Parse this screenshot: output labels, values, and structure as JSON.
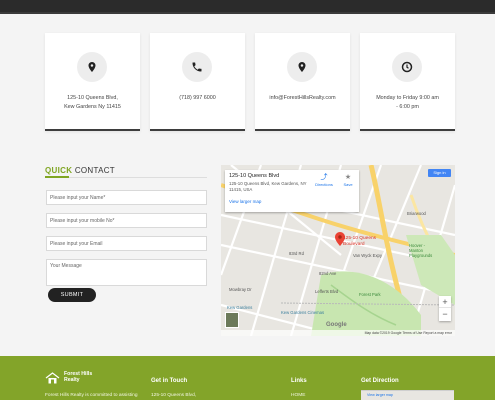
{
  "contact_cards": [
    {
      "icon": "map-pin-icon",
      "text": "125-10 Queens Blvd, Kew Gardens Ny 11415"
    },
    {
      "icon": "phone-icon",
      "text": "(718) 997 6000"
    },
    {
      "icon": "map-pin-icon",
      "text": "info@ForestHillsRealty.com"
    },
    {
      "icon": "clock-icon",
      "text": "Monday to Friday 9:00 am - 6:00 pm"
    }
  ],
  "quick_contact": {
    "title_highlight": "QUICK",
    "title_rest": "CONTACT",
    "name_placeholder": "Please input your Name*",
    "mobile_placeholder": "Please input your mobile No*",
    "email_placeholder": "Please input your Email",
    "message_placeholder": "Your Message",
    "submit_label": "SUBMIT"
  },
  "map": {
    "place_title": "125-10 Queens Blvd",
    "place_address": "125-10 Queens Blvd, Kew Gardens, NY 11415, USA",
    "larger_map": "View larger map",
    "directions": "Directions",
    "save": "Save",
    "sign_in": "Sign in",
    "pin_label": "125-10 Queens Boulevard",
    "zoom_in": "+",
    "zoom_out": "−",
    "google": "Google",
    "attribution": "Map data ©2019 Google   Terms of Use   Report a map error",
    "labels": {
      "kew_gardens": "Kew Gardens",
      "cinemas": "Kew Gardens Cinemas",
      "hoover": "Hoover - Manton Playgrounds",
      "briarwood": "Briarwood",
      "lefferts": "Lefferts Blvd",
      "mowbray": "Mowbray Dr",
      "van_wyck": "Van Wyck Expy",
      "ave_82": "82nd Ave",
      "rd_83": "83rd Rd",
      "park": "Forest Park"
    }
  },
  "footer": {
    "brand_line1": "Forest Hills",
    "brand_line2": "Realty",
    "description": "Forest Hills Realty is committed to assisting",
    "get_in_touch": "Get in Touch",
    "address_short": "125-10 Queens Blvd,",
    "links": "Links",
    "home": "HOME",
    "get_direction": "Get Direction",
    "footer_map_link": "View larger map"
  },
  "colors": {
    "accent": "#83a429",
    "dark": "#222222"
  }
}
